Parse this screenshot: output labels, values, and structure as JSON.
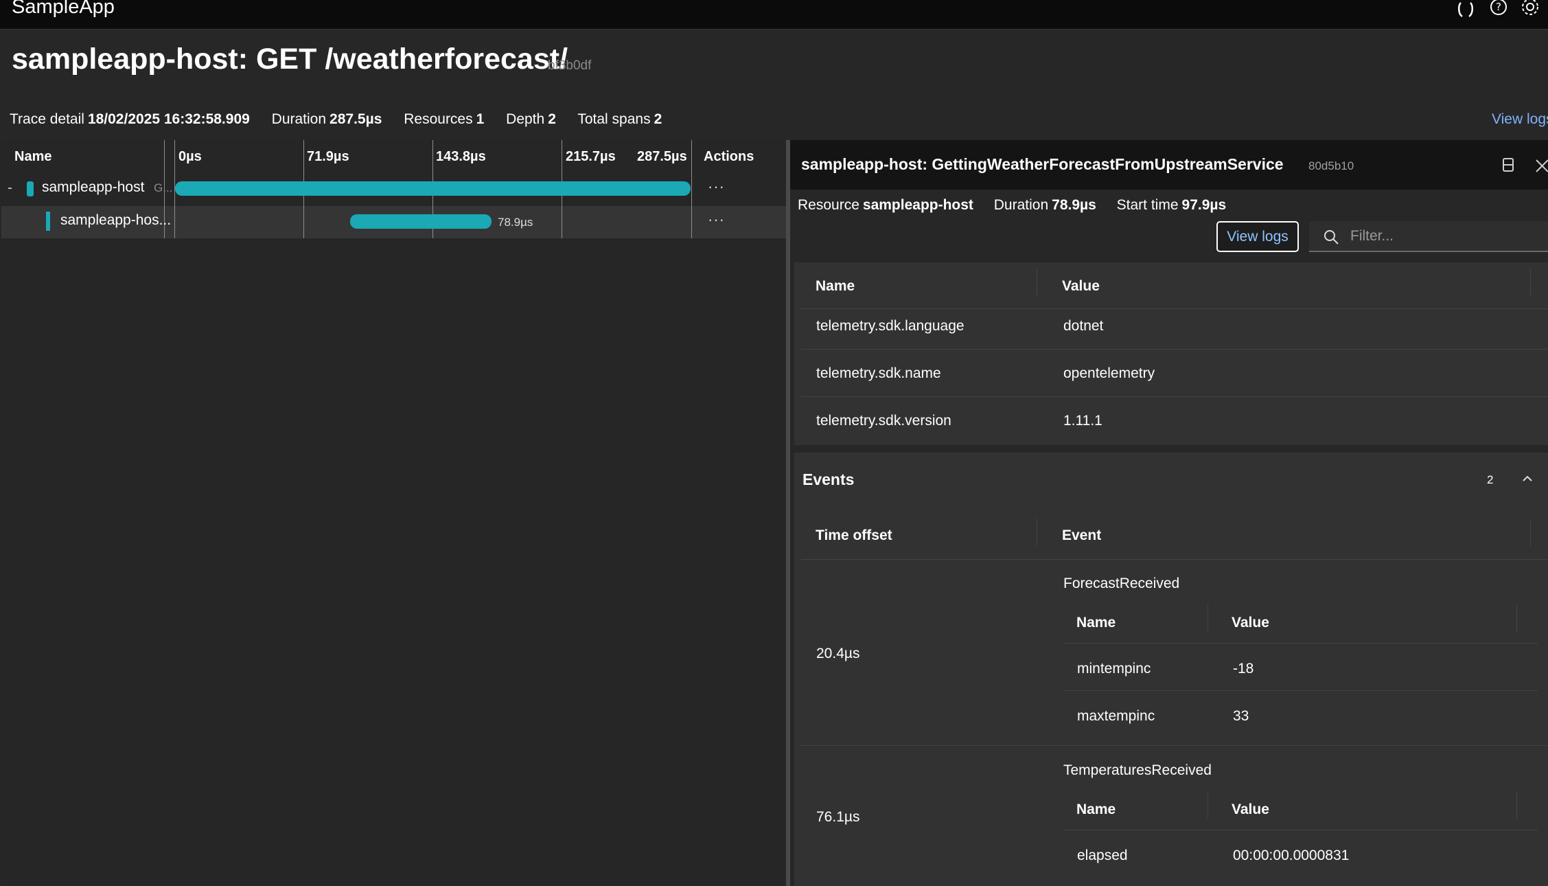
{
  "app": {
    "title": "SampleApp"
  },
  "header": {
    "title": "sampleapp-host: GET /weatherforecast/",
    "trace_id": "bf3b0df",
    "meta": [
      {
        "label": "Trace detail",
        "value": "18/02/2025 16:32:58.909"
      },
      {
        "label": "Duration",
        "value": "287.5µs"
      },
      {
        "label": "Resources",
        "value": "1"
      },
      {
        "label": "Depth",
        "value": "2"
      },
      {
        "label": "Total spans",
        "value": "2"
      }
    ],
    "view_logs_link": "View logs"
  },
  "timeline": {
    "name_header": "Name",
    "actions_header": "Actions",
    "ticks": [
      "0µs",
      "71.9µs",
      "143.8µs",
      "215.7µs",
      "287.5µs"
    ],
    "rows": [
      {
        "toggle": "-",
        "name": "sampleapp-host",
        "suffix": "G...",
        "actions": "···"
      },
      {
        "name": "sampleapp-hos...",
        "bar_label": "78.9µs",
        "actions": "···"
      }
    ]
  },
  "span_detail": {
    "title": "sampleapp-host: GettingWeatherForecastFromUpstreamService",
    "span_id": "80d5b10",
    "meta": [
      {
        "label": "Resource",
        "value": "sampleapp-host"
      },
      {
        "label": "Duration",
        "value": "78.9µs"
      },
      {
        "label": "Start time",
        "value": "97.9µs"
      }
    ],
    "view_logs_button": "View logs",
    "filter_placeholder": "Filter...",
    "attributes": {
      "headers": [
        "Name",
        "Value"
      ],
      "rows": [
        [
          "telemetry.sdk.language",
          "dotnet"
        ],
        [
          "telemetry.sdk.name",
          "opentelemetry"
        ],
        [
          "telemetry.sdk.version",
          "1.11.1"
        ]
      ]
    },
    "events": {
      "title": "Events",
      "count": "2",
      "headers": [
        "Time offset",
        "Event"
      ],
      "items": [
        {
          "offset": "20.4µs",
          "name": "ForecastReceived",
          "headers": [
            "Name",
            "Value"
          ],
          "rows": [
            [
              "mintempinc",
              "-18"
            ],
            [
              "maxtempinc",
              "33"
            ]
          ]
        },
        {
          "offset": "76.1µs",
          "name": "TemperaturesReceived",
          "headers": [
            "Name",
            "Value"
          ],
          "rows": [
            [
              "elapsed",
              "00:00:00.0000831"
            ]
          ]
        }
      ]
    }
  },
  "colors": {
    "accent_bar": "#1aa9b5",
    "link": "#7fb3ff",
    "background": "#272727"
  }
}
